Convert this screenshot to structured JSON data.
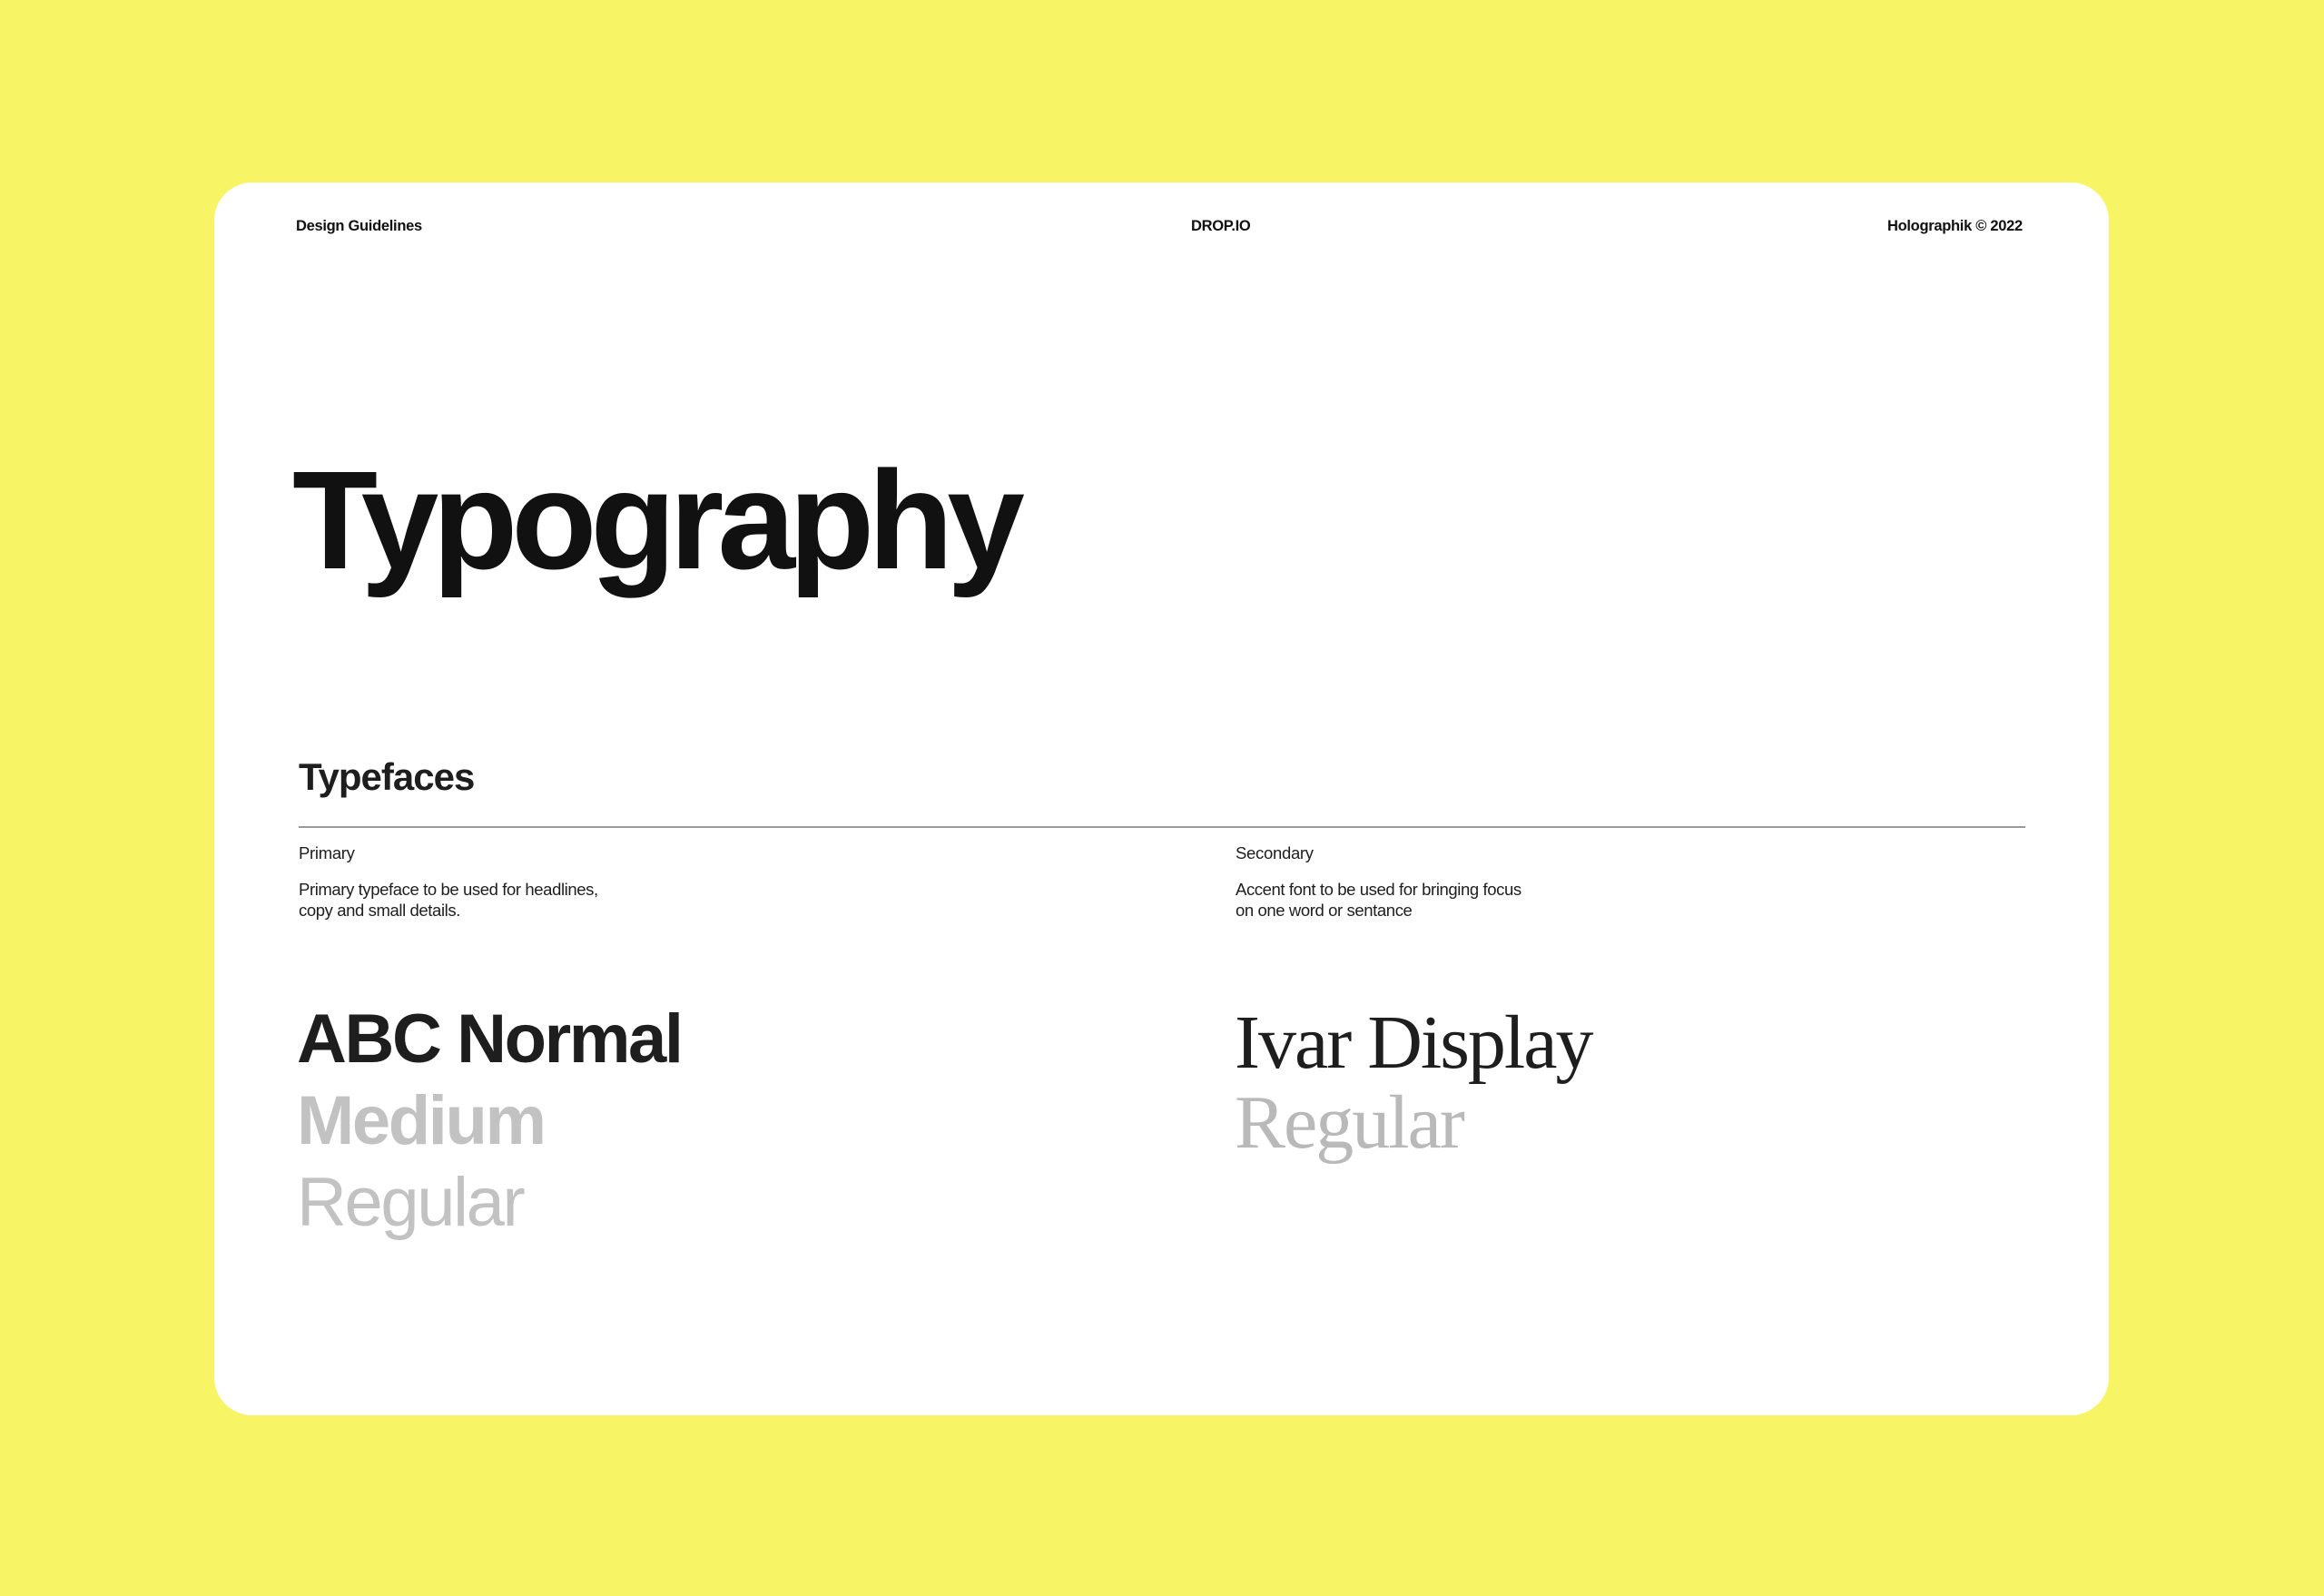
{
  "colors": {
    "background": "#f7f466",
    "card": "#ffffff",
    "text_dark": "#1e1e1e",
    "text_muted": "#c2c2c2",
    "rule": "#9a9a9a"
  },
  "header": {
    "left": "Design Guidelines",
    "center": "DROP.IO",
    "right": "Holographik © 2022"
  },
  "page": {
    "title": "Typography",
    "section_title": "Typefaces"
  },
  "typefaces": {
    "primary": {
      "label": "Primary",
      "description": "Primary typeface to be used for headlines, copy and small details.",
      "samples": [
        "ABC Normal",
        "Medium",
        "Regular"
      ]
    },
    "secondary": {
      "label": "Secondary",
      "description": "Accent font to be used for bringing focus on one word or sentance",
      "samples": [
        "Ivar Display",
        "Regular"
      ]
    }
  }
}
